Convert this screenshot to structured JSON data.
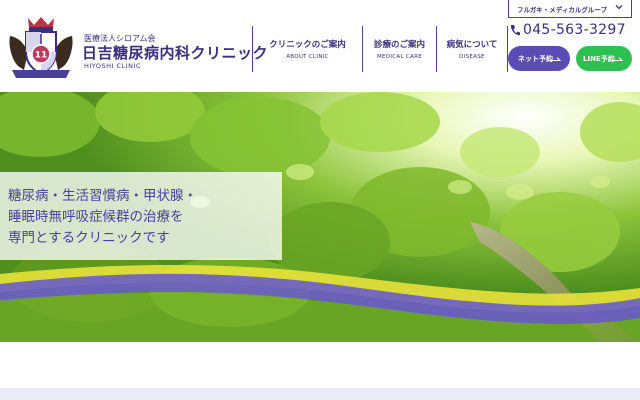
{
  "header": {
    "org_name": "医療法人シロアム会",
    "clinic_name": "日吉糖尿病内科クリニック",
    "clinic_name_en": "HIYOSHI CLINIC",
    "logo_badge": "11"
  },
  "nav": {
    "items": [
      {
        "label": "クリニックのご案内",
        "sub": "ABOUT CLINIC"
      },
      {
        "label": "診療のご案内",
        "sub": "MEDICAL CARE"
      },
      {
        "label": "病気について",
        "sub": "DISEASE"
      }
    ]
  },
  "group_menu": {
    "label": "フルガキ・メディカルグループ",
    "icon": "chevron-down-icon"
  },
  "contact": {
    "phone": "045-563-3297",
    "phone_icon": "phone-icon",
    "net_reserve_label": "ネット予約",
    "line_reserve_label": "LINE予約"
  },
  "hero": {
    "tagline": [
      "糖尿病・生活習慣病・甲状腺・",
      "睡眠時無呼吸症候群の治療を",
      "専門とするクリニックです"
    ]
  },
  "colors": {
    "brand_purple": "#4a3f9a",
    "net_button": "#5b4bb5",
    "line_button": "#2dc152",
    "hero_stripe_yellow": "#e8e23a",
    "hero_stripe_purple": "#6a5cc8"
  }
}
